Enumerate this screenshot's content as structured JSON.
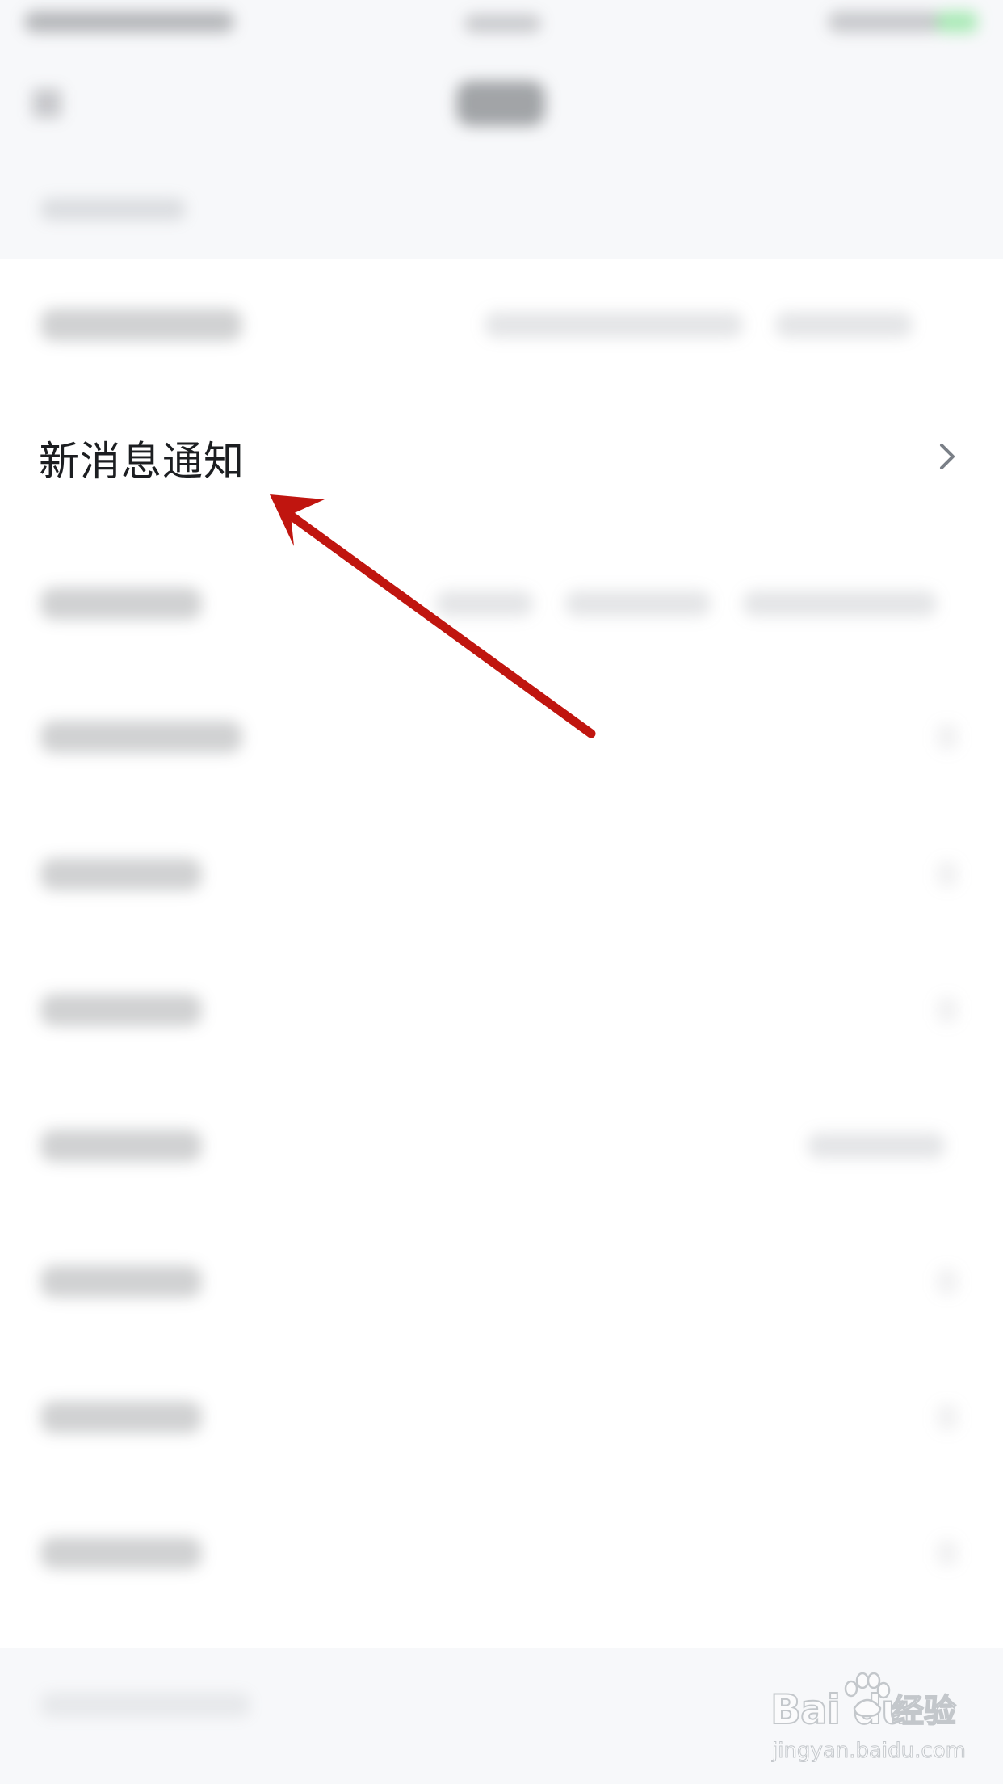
{
  "settings_list": {
    "highlighted_item": {
      "label": "新消息通知",
      "chevron_icon": "chevron-right-icon"
    }
  },
  "annotation": {
    "arrow_color": "#c0150f",
    "arrow_icon": "arrow-pointer-icon"
  },
  "watermark": {
    "brand_latin": "Bai  du",
    "brand_cn": "经验",
    "url": "jingyan.baidu.com",
    "paw_icon": "baidu-paw-icon"
  },
  "colors": {
    "background": "#f7f8fa",
    "row_background": "#ffffff",
    "text_primary": "#1c1e21",
    "chevron": "#7a7f87"
  }
}
